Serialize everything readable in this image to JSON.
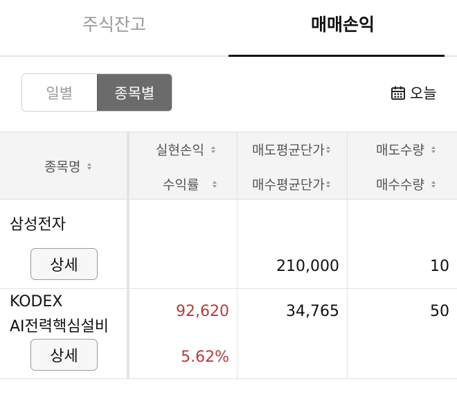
{
  "tabs": [
    {
      "label": "주식잔고",
      "active": false
    },
    {
      "label": "매매손익",
      "active": true
    }
  ],
  "toggle": {
    "daily": "일별",
    "by_stock": "종목별",
    "selected": "종목별"
  },
  "date_selector": {
    "label": "오늘",
    "icon": "calendar-icon"
  },
  "table": {
    "headers": {
      "name": "종목명",
      "realized_pl": "실현손익",
      "return_rate": "수익률",
      "sell_avg_price": "매도평균단가",
      "buy_avg_price": "매수평균단가",
      "sell_qty": "매도수량",
      "buy_qty": "매수수량"
    },
    "rows": [
      {
        "name": "삼성전자",
        "realized_pl": "",
        "return_rate": "",
        "sell_avg_price": "",
        "buy_avg_price": "210,000",
        "sell_qty": "",
        "buy_qty": "10",
        "detail_label": "상세"
      },
      {
        "name_line1": "KODEX",
        "name_line2": "AI전력핵심설비",
        "realized_pl": "92,620",
        "return_rate": "5.62%",
        "sell_avg_price": "34,765",
        "buy_avg_price": "",
        "sell_qty": "50",
        "buy_qty": "",
        "detail_label": "상세"
      }
    ]
  },
  "colors": {
    "profit": "#b83a3a",
    "toggle_active": "#6b6b6b",
    "header_bg": "#f4f4f4"
  }
}
